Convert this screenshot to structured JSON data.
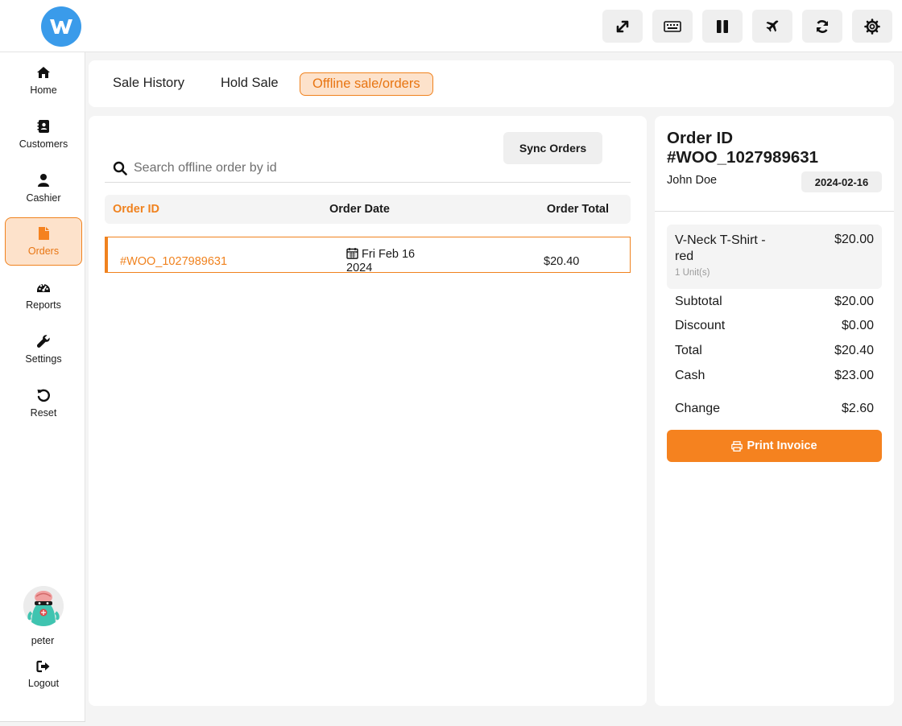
{
  "topbar": {
    "buttons": [
      {
        "icon": "expand-icon"
      },
      {
        "icon": "keyboard-icon"
      },
      {
        "icon": "pause-icon"
      },
      {
        "icon": "airplane-icon"
      },
      {
        "icon": "sync-icon"
      },
      {
        "icon": "gear-icon"
      }
    ]
  },
  "sidebar": {
    "items": [
      {
        "label": "Home",
        "icon": "home-icon"
      },
      {
        "label": "Customers",
        "icon": "address-book-icon"
      },
      {
        "label": "Cashier",
        "icon": "user-icon"
      },
      {
        "label": "Orders",
        "icon": "file-icon",
        "active": true
      },
      {
        "label": "Reports",
        "icon": "dashboard-icon"
      },
      {
        "label": "Settings",
        "icon": "wrench-icon"
      },
      {
        "label": "Reset",
        "icon": "undo-icon"
      }
    ],
    "user": {
      "name": "peter"
    },
    "logout_label": "Logout"
  },
  "tabs": [
    {
      "label": "Sale History"
    },
    {
      "label": "Hold Sale"
    },
    {
      "label": "Offline sale/orders",
      "active": true
    }
  ],
  "orders": {
    "search_placeholder": "Search offline order by id",
    "sync_label": "Sync Orders",
    "columns": [
      "Order ID",
      "Order Date",
      "Order Total"
    ],
    "rows": [
      {
        "id": "#WOO_1027989631",
        "date_line1": "Fri Feb 16",
        "date_line2": "2024",
        "total": "$20.40"
      }
    ]
  },
  "detail": {
    "title_line1": "Order ID",
    "title_line2": "#WOO_1027989631",
    "customer": "John Doe",
    "date": "2024-02-16",
    "items": [
      {
        "name": "V-Neck T-Shirt - red",
        "price": "$20.00",
        "units": "1 Unit(s)"
      }
    ],
    "summary": [
      {
        "label": "Subtotal",
        "value": "$20.00"
      },
      {
        "label": "Discount",
        "value": "$0.00"
      },
      {
        "label": "Total",
        "value": "$20.40"
      },
      {
        "label": "Cash",
        "value": "$23.00"
      },
      {
        "label": "Change",
        "value": "$2.60"
      }
    ],
    "print_label": "Print Invoice"
  },
  "colors": {
    "accent": "#f5821f",
    "accent_soft": "#fde2cb",
    "logo": "#3a9bea"
  }
}
